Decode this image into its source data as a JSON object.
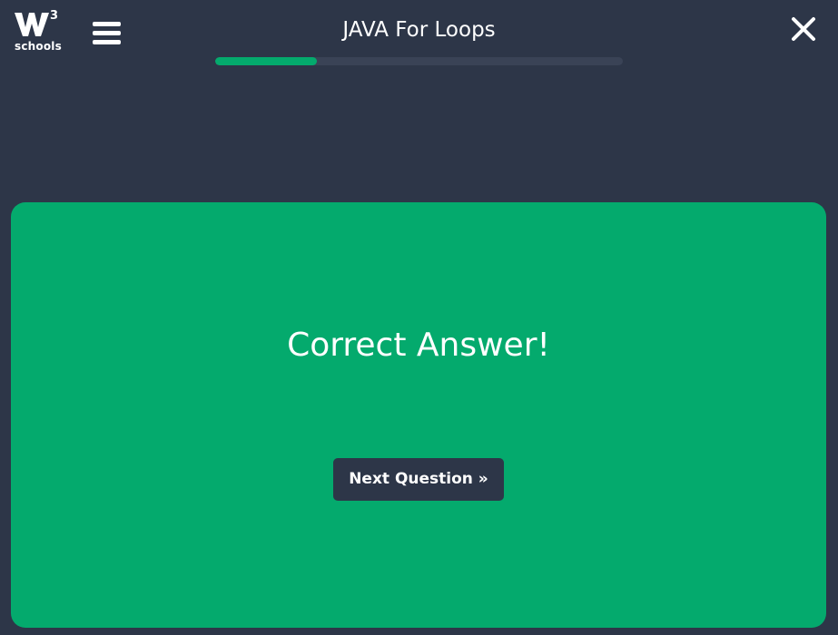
{
  "header": {
    "logo": {
      "superscript": "3",
      "wordmark": "schools",
      "icon": "w3schools-logo-icon"
    },
    "menu_icon": "hamburger-menu-icon",
    "title": "JAVA For Loops",
    "progress": {
      "fraction": 0.25,
      "track_color": "#3a4356",
      "fill_color": "#04aa6d"
    },
    "close_icon": "close-icon"
  },
  "result": {
    "message": "Correct Answer!",
    "next_button_label": "Next Question »",
    "card_color": "#04aa6d"
  },
  "colors": {
    "background": "#2d3648",
    "accent": "#04aa6d",
    "text": "#ffffff"
  }
}
